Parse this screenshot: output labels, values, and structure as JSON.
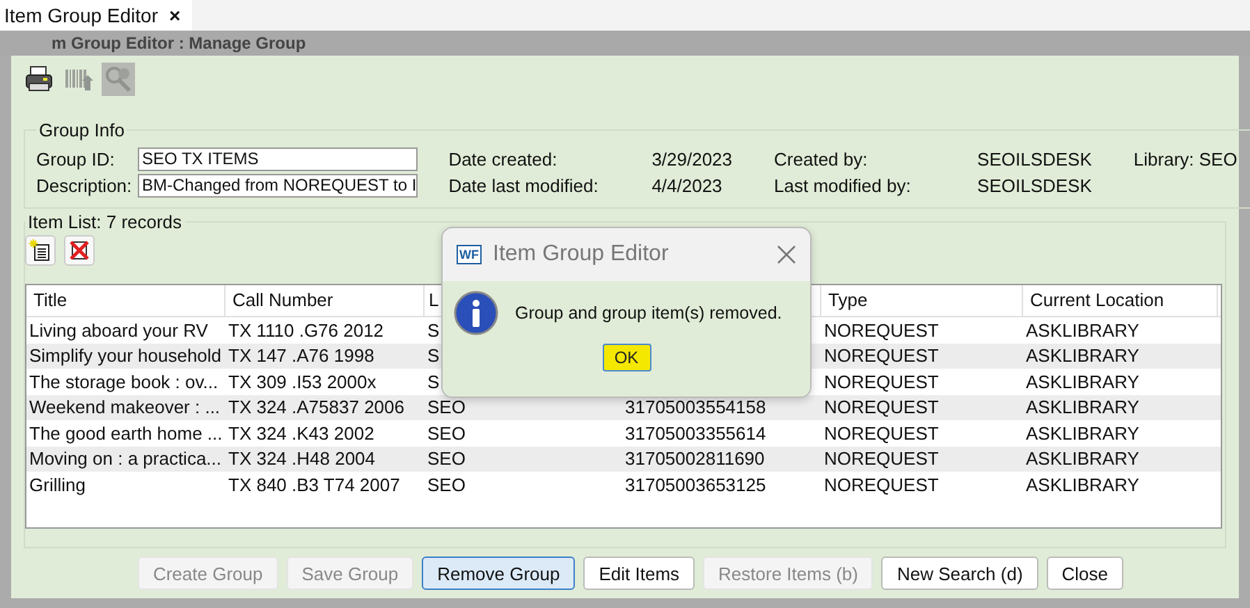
{
  "tab": {
    "title": "Item Group Editor",
    "close": "×",
    "selected": true
  },
  "header": "m Group Editor : Manage Group",
  "toolbar": [
    {
      "kind": "printer",
      "disabled": false
    },
    {
      "kind": "barcode",
      "disabled": true
    },
    {
      "kind": "search",
      "disabled": true
    }
  ],
  "group_info": {
    "legend": "Group Info",
    "fields": [
      {
        "label": "Group ID:",
        "value": "SEO TX ITEMS"
      },
      {
        "label": "Description:",
        "value": "BM-Changed from NOREQUEST to I"
      }
    ],
    "details": [
      [
        {
          "label": "Date created:",
          "value": "3/29/2023"
        },
        {
          "label": "Created by:",
          "value": "SEOILSDESK"
        },
        {
          "label": "Library: SEO"
        }
      ],
      [
        {
          "label": "Date last modified:",
          "value": "4/4/2023"
        },
        {
          "label": "Last modified by:",
          "value": "SEOILSDESK"
        }
      ]
    ]
  },
  "item_list": {
    "legend": "Item List: 7 records",
    "tools": [
      {
        "kind": "add"
      },
      {
        "kind": "remove"
      }
    ],
    "columns": [
      "Title",
      "Call Number",
      "L",
      null,
      "Type",
      "Current Location"
    ],
    "rows": [
      [
        "Living aboard your RV",
        "TX 1110 .G76 2012",
        "S",
        null,
        "NOREQUEST",
        "ASKLIBRARY"
      ],
      [
        "Simplify your household",
        "TX 147 .A76 1998",
        "S",
        null,
        "NOREQUEST",
        "ASKLIBRARY"
      ],
      [
        "The storage book : ov...",
        "TX 309 .I53 2000x",
        "S",
        null,
        "NOREQUEST",
        "ASKLIBRARY"
      ],
      [
        "Weekend makeover : ...",
        "TX 324 .A75837 2006",
        "SEO",
        "31705003554158",
        "NOREQUEST",
        "ASKLIBRARY"
      ],
      [
        "The good earth home ...",
        "TX 324 .K43 2002",
        "SEO",
        "31705003355614",
        "NOREQUEST",
        "ASKLIBRARY"
      ],
      [
        "Moving on : a practica...",
        "TX 324 .H48 2004",
        "SEO",
        "31705002811690",
        "NOREQUEST",
        "ASKLIBRARY"
      ],
      [
        "Grilling",
        "TX 840 .B3 T74 2007",
        "SEO",
        "31705003653125",
        "NOREQUEST",
        "ASKLIBRARY"
      ]
    ]
  },
  "buttons": [
    {
      "label": "Create Group",
      "disabled": true,
      "focused": false
    },
    {
      "label": "Save Group",
      "disabled": true,
      "focused": false
    },
    {
      "label": "Remove Group",
      "disabled": false,
      "focused": true
    },
    {
      "label": "Edit Items",
      "disabled": false,
      "focused": false
    },
    {
      "label": "Restore Items (b)",
      "disabled": true,
      "focused": false
    },
    {
      "label": "New Search (d)",
      "disabled": false,
      "focused": false
    },
    {
      "label": "Close",
      "disabled": false,
      "focused": false
    }
  ],
  "dialog": {
    "title": "Item Group Editor",
    "app_icon": "WF",
    "message": "Group and group item(s) removed.",
    "button": "OK"
  }
}
